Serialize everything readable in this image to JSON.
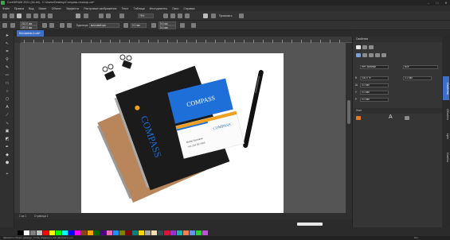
{
  "app": {
    "title": "CorelDRAW 2021 (64-bit) - C:\\Users\\Desktop\\Compass-mockup.cdr*",
    "window_controls": [
      "–",
      "□",
      "✕"
    ]
  },
  "menu": {
    "items": [
      "Файл",
      "Правка",
      "Вид",
      "Макет",
      "Объект",
      "Эффекты",
      "Растровые изображения",
      "Текст",
      "Таблица",
      "Инструменты",
      "Окно",
      "Справка"
    ]
  },
  "toolbar1": {
    "zoom_value": "75%",
    "snap_label": "Привязать"
  },
  "toolbar2": {
    "width_value": "210.0 мм",
    "height_value": "297.0 мм",
    "units_label": "Единицы:",
    "units_value": "миллиметры",
    "nudge_value": "0.1 мм",
    "dup_x": "5.0 мм",
    "dup_y": "5.0 мм"
  },
  "document": {
    "tab_label": "Без имени-1.cdr*"
  },
  "page": {
    "status_items": [
      "1 из 1",
      "Страница 1"
    ],
    "page_tab": "Страница 1"
  },
  "artwork": {
    "brand": "COMPASS",
    "card_brand": "COMPASS",
    "card_name": "Name Surname",
    "card_phone": "+01 234 567 890"
  },
  "dock": {
    "header_properties": "Свойства",
    "fill_label": "Нет заливки",
    "outline_value": "0.2 мм",
    "outline_style": "Всё",
    "rows": [
      {
        "label": "В",
        "value": "100.0 %"
      },
      {
        "label": "Ш",
        "value": "0.0 мм"
      },
      {
        "label": "У",
        "value": "0.0 мм"
      },
      {
        "label": "Р",
        "value": "0.0 мм"
      }
    ],
    "section_label": "Угол",
    "text_label": "A"
  },
  "side_tabs": [
    "Свойства",
    "Объекты",
    "Цвет",
    "Советы"
  ],
  "statusbar": {
    "left": "Щелкните объект дважды, чтобы повернуть или наклонить его",
    "right": "Нет"
  },
  "palette": {
    "colors": [
      "#000000",
      "#ffffff",
      "#7f7f7f",
      "#c0c0c0",
      "#ff0000",
      "#ffff00",
      "#00ff00",
      "#00ffff",
      "#0000ff",
      "#ff00ff",
      "#8b4513",
      "#ffa500",
      "#006400",
      "#4b0082",
      "#ff69b4",
      "#1e90ff",
      "#808000",
      "#800000",
      "#008080",
      "#ffd700",
      "#a9a9a9",
      "#f5deb3",
      "#2f4f4f",
      "#dc143c",
      "#9932cc",
      "#20b2aa",
      "#ff7f50",
      "#6495ed",
      "#32cd32",
      "#ba55d3"
    ]
  }
}
